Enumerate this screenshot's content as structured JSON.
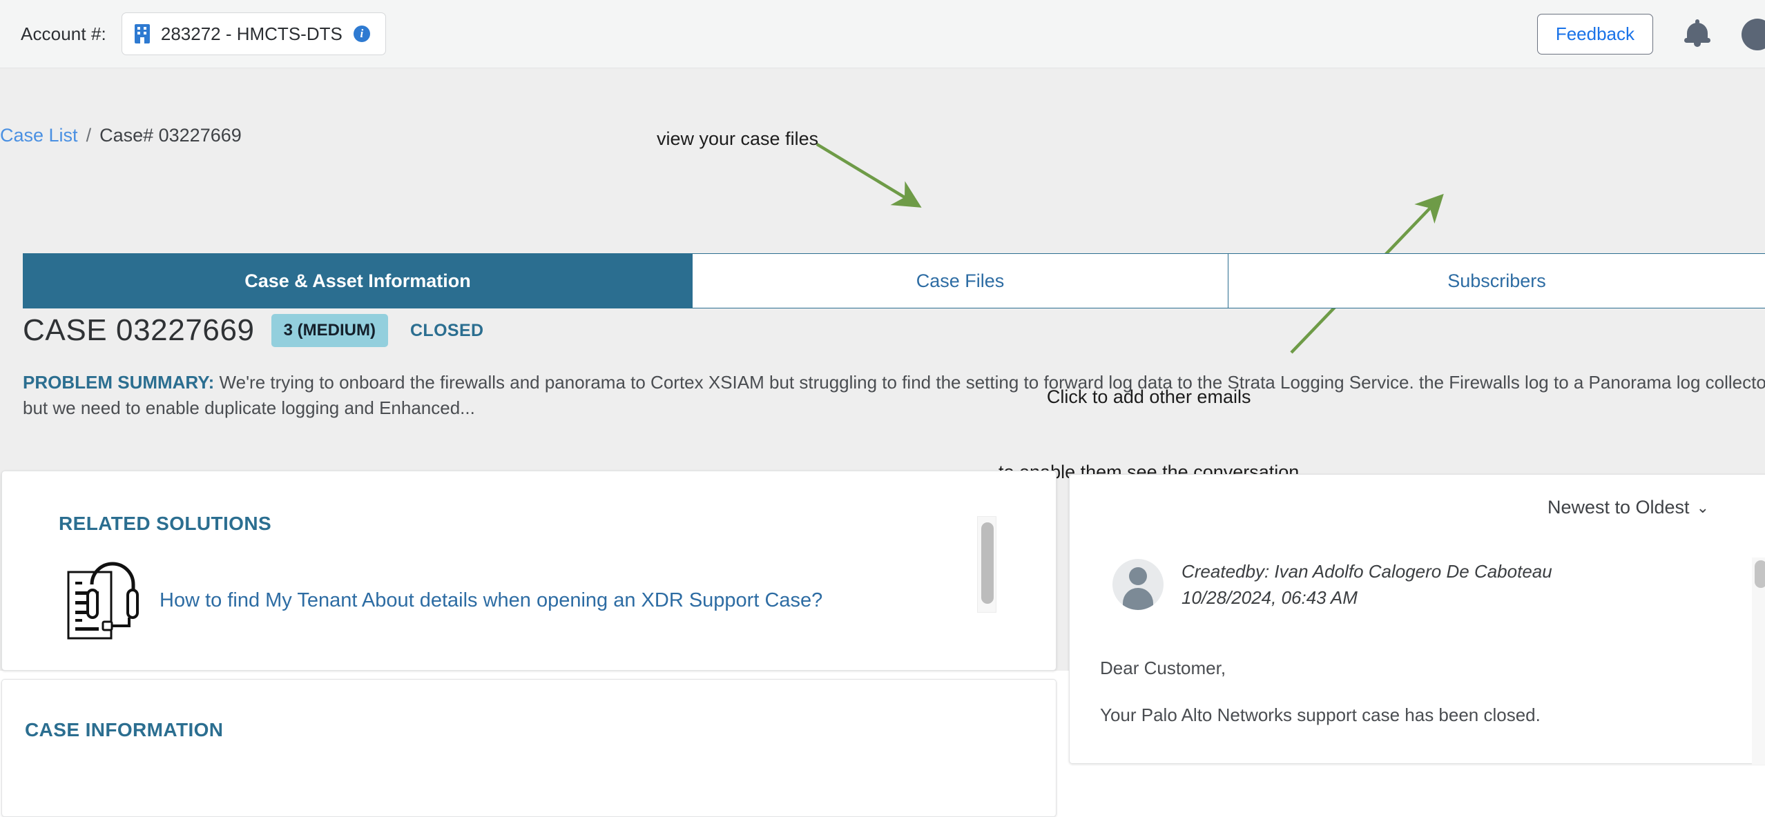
{
  "topbar": {
    "account_label": "Account #:",
    "account_value": "283272 - HMCTS-DTS",
    "building_icon": "building-icon",
    "info_icon": "i",
    "feedback_label": "Feedback",
    "bell_icon": "notification-bell-icon",
    "avatar_icon": "user-avatar-icon"
  },
  "breadcrumb": {
    "root_label": "Case List",
    "separator": "/",
    "current_label": "Case# 03227669"
  },
  "annotations": {
    "case_files_note": "view your case files",
    "subscribers_note_line1": "Click to add other emails",
    "subscribers_note_line2": "to enable them see the conversation",
    "arrow_color": "#6e9b47"
  },
  "tabs": [
    {
      "label": "Case & Asset Information",
      "active": true
    },
    {
      "label": "Case Files",
      "active": false
    },
    {
      "label": "Subscribers",
      "active": false
    }
  ],
  "case_header": {
    "title": "CASE 03227669",
    "severity_badge": "3 (MEDIUM)",
    "status_badge": "CLOSED",
    "severity_color": "#93cfdd",
    "status_color": "#2b6e90"
  },
  "problem_summary": {
    "label": "PROBLEM SUMMARY:",
    "text": " We're trying to onboard the firewalls and panorama to Cortex XSIAM but struggling to find the setting to forward log data to the Strata Logging Service. the Firewalls log to a Panorama log collector but we need to enable duplicate logging and Enhanced..."
  },
  "related_solutions": {
    "section_title": "RELATED SOLUTIONS",
    "item_icon": "document-headset-icon",
    "item_link": "How to find My Tenant About details when opening an XDR Support Case?"
  },
  "case_information": {
    "section_title": "CASE INFORMATION"
  },
  "conversation": {
    "sort_label": "Newest to Oldest",
    "sort_chevron": "⌄",
    "message": {
      "author_line": "Createdby: Ivan Adolfo Calogero De Caboteau",
      "timestamp": "10/28/2024, 06:43 AM",
      "greeting": "Dear Customer,",
      "body": "Your Palo Alto Networks support case has been closed."
    }
  }
}
